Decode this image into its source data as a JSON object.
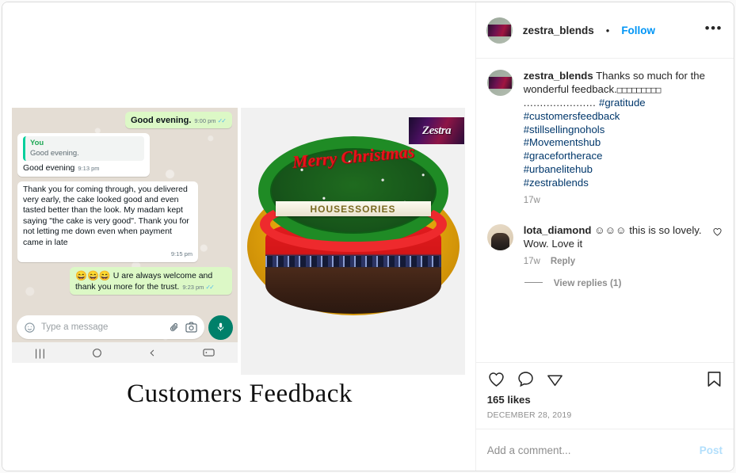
{
  "post": {
    "header": {
      "username": "zestra_blends",
      "separator": "•",
      "follow_label": "Follow",
      "more_menu": "•••"
    },
    "caption": {
      "username": "zestra_blends",
      "text": "Thanks so much for the wonderful feedback.",
      "emoji_run": "□□□□□□□□□",
      "dots": "......................",
      "hashtags": [
        "#gratitude",
        "#customersfeedback",
        "#stillsellingnohols",
        "#Movementshub",
        "#gracefortherace",
        "#urbanelitehub",
        "#zestrablends"
      ],
      "timestamp": "17w"
    },
    "comments": [
      {
        "username": "lota_diamond",
        "emoji": "☺☺☺",
        "text": "this is so lovely. Wow. Love it",
        "timestamp": "17w",
        "reply_label": "Reply"
      }
    ],
    "view_replies_label": "View replies (1)",
    "actions": {
      "like_icon": "heart-icon",
      "comment_icon": "comment-bubble-icon",
      "share_icon": "share-paperplane-icon",
      "save_icon": "bookmark-icon"
    },
    "likes": "165 likes",
    "date": "DECEMBER 28, 2019",
    "add_comment": {
      "placeholder": "Add a comment...",
      "post_label": "Post"
    }
  },
  "media": {
    "bottom_title": "Customers Feedback",
    "watermark": "Zestra",
    "whatsapp": {
      "messages": [
        {
          "side": "out",
          "text": "Good evening.",
          "time": "9:00 pm",
          "ticks": "✓✓"
        },
        {
          "side": "in",
          "quote_name": "You",
          "quote_text": "Good evening.",
          "text": "Good evening",
          "time": "9:13 pm"
        },
        {
          "side": "in",
          "text": "Thank you for coming through, you delivered very early, the cake looked good and even tasted better than the look. My madam kept saying \"the cake is very good\". Thank you for not letting me down even when payment came in late",
          "time": "9:15 pm"
        },
        {
          "side": "out",
          "emoji": "😄😄😄",
          "text": "U are always welcome and thank you more for the trust.",
          "time": "9:23 pm",
          "ticks": "✓✓"
        }
      ],
      "composer": {
        "placeholder": "Type a message",
        "emoji_icon": "smiley-icon",
        "attach_icon": "paperclip-icon",
        "camera_icon": "camera-icon",
        "mic_icon": "microphone-icon"
      },
      "navbar": {
        "recents_icon": "recents-icon",
        "home_icon": "home-icon",
        "back_icon": "back-icon",
        "keyboard_icon": "keyboard-icon"
      }
    },
    "cake": {
      "greeting": "Merry Christmas",
      "banner_text": "HOUSESSORIES"
    }
  }
}
